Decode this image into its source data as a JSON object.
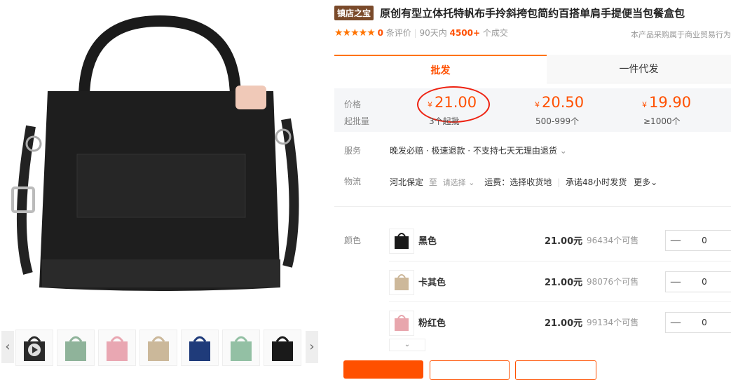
{
  "product": {
    "badge": "镇店之宝",
    "title": "原创有型立体托特帆布手拎斜挎包简约百搭单肩手提便当包餐盒包"
  },
  "rating": {
    "stars": "★★★★★",
    "review_count": "0",
    "review_label": "条评价",
    "sold_prefix": "90天内",
    "sold_count": "4500+",
    "sold_suffix": "个成交",
    "notice": "本产品采购属于商业贸易行为"
  },
  "tabs": [
    {
      "label": "批发",
      "active": true
    },
    {
      "label": "一件代发",
      "active": false
    }
  ],
  "pricing": {
    "price_label": "价格",
    "moq_label": "起批量",
    "currency": "¥",
    "tiers": [
      {
        "price": "21.00",
        "range": "3个起批"
      },
      {
        "price": "20.50",
        "range": "500-999个"
      },
      {
        "price": "19.90",
        "range": "≥1000个"
      }
    ]
  },
  "service": {
    "label": "服务",
    "text": "晚发必赔 · 极速退款 · 不支持七天无理由退货"
  },
  "logistics": {
    "label": "物流",
    "origin": "河北保定",
    "to": "至",
    "select": "请选择",
    "freight": "运费：选择收货地",
    "promise": "承诺48小时发货",
    "more": "更多"
  },
  "colors": {
    "label": "颜色",
    "unit": "元",
    "stock_suffix": "个可售",
    "items": [
      {
        "name": "黑色",
        "price": "21.00",
        "stock": "96434",
        "qty": "0",
        "swatch": "#1a1a1a"
      },
      {
        "name": "卡其色",
        "price": "21.00",
        "stock": "98076",
        "qty": "0",
        "swatch": "#cdb89a"
      },
      {
        "name": "粉红色",
        "price": "21.00",
        "stock": "99134",
        "qty": "0",
        "swatch": "#e8a6ad"
      }
    ]
  },
  "thumbnails": [
    {
      "color": "#2a2a2a",
      "video": true
    },
    {
      "color": "#8fb39a"
    },
    {
      "color": "#e9a7b2"
    },
    {
      "color": "#cbb89a"
    },
    {
      "color": "#1f3b7a"
    },
    {
      "color": "#93c0a4"
    },
    {
      "color": "#1a1a1a"
    }
  ],
  "accent": "#ff5000"
}
